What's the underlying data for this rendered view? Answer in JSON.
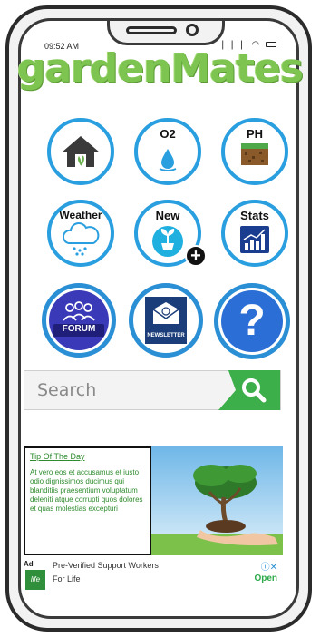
{
  "status_bar": {
    "time": "09:52 AM",
    "signal": "❘❘❘",
    "wifi": "◠"
  },
  "app": {
    "title": "gardenMates"
  },
  "tiles": [
    {
      "id": "home",
      "label": ""
    },
    {
      "id": "o2",
      "label": "O2"
    },
    {
      "id": "ph",
      "label": "PH"
    },
    {
      "id": "weather",
      "label": "Weather"
    },
    {
      "id": "new",
      "label": "New"
    },
    {
      "id": "stats",
      "label": "Stats"
    },
    {
      "id": "forum",
      "label": "FORUM"
    },
    {
      "id": "newsletter",
      "label": "NEWSLETTER"
    },
    {
      "id": "help",
      "label": "?"
    }
  ],
  "search": {
    "placeholder": "Search"
  },
  "tip": {
    "title": "Tip Of The Day",
    "body": "At vero eos et accusamus et iusto odio dignissimos ducimus qui blanditiis praesentium voluptatum deleniti atque corrupti quos dolores et quas molestias excepturi"
  },
  "ad": {
    "label": "Ad",
    "logo_text": "life",
    "title": "Pre-Verified Support Workers",
    "subtitle": "For Life",
    "close": "ⓘ✕",
    "cta": "Open"
  },
  "colors": {
    "accent": "#2a9fe0",
    "brand_green": "#7ec451",
    "search_green": "#3cae4a",
    "tip_text": "#2e8b2e"
  }
}
